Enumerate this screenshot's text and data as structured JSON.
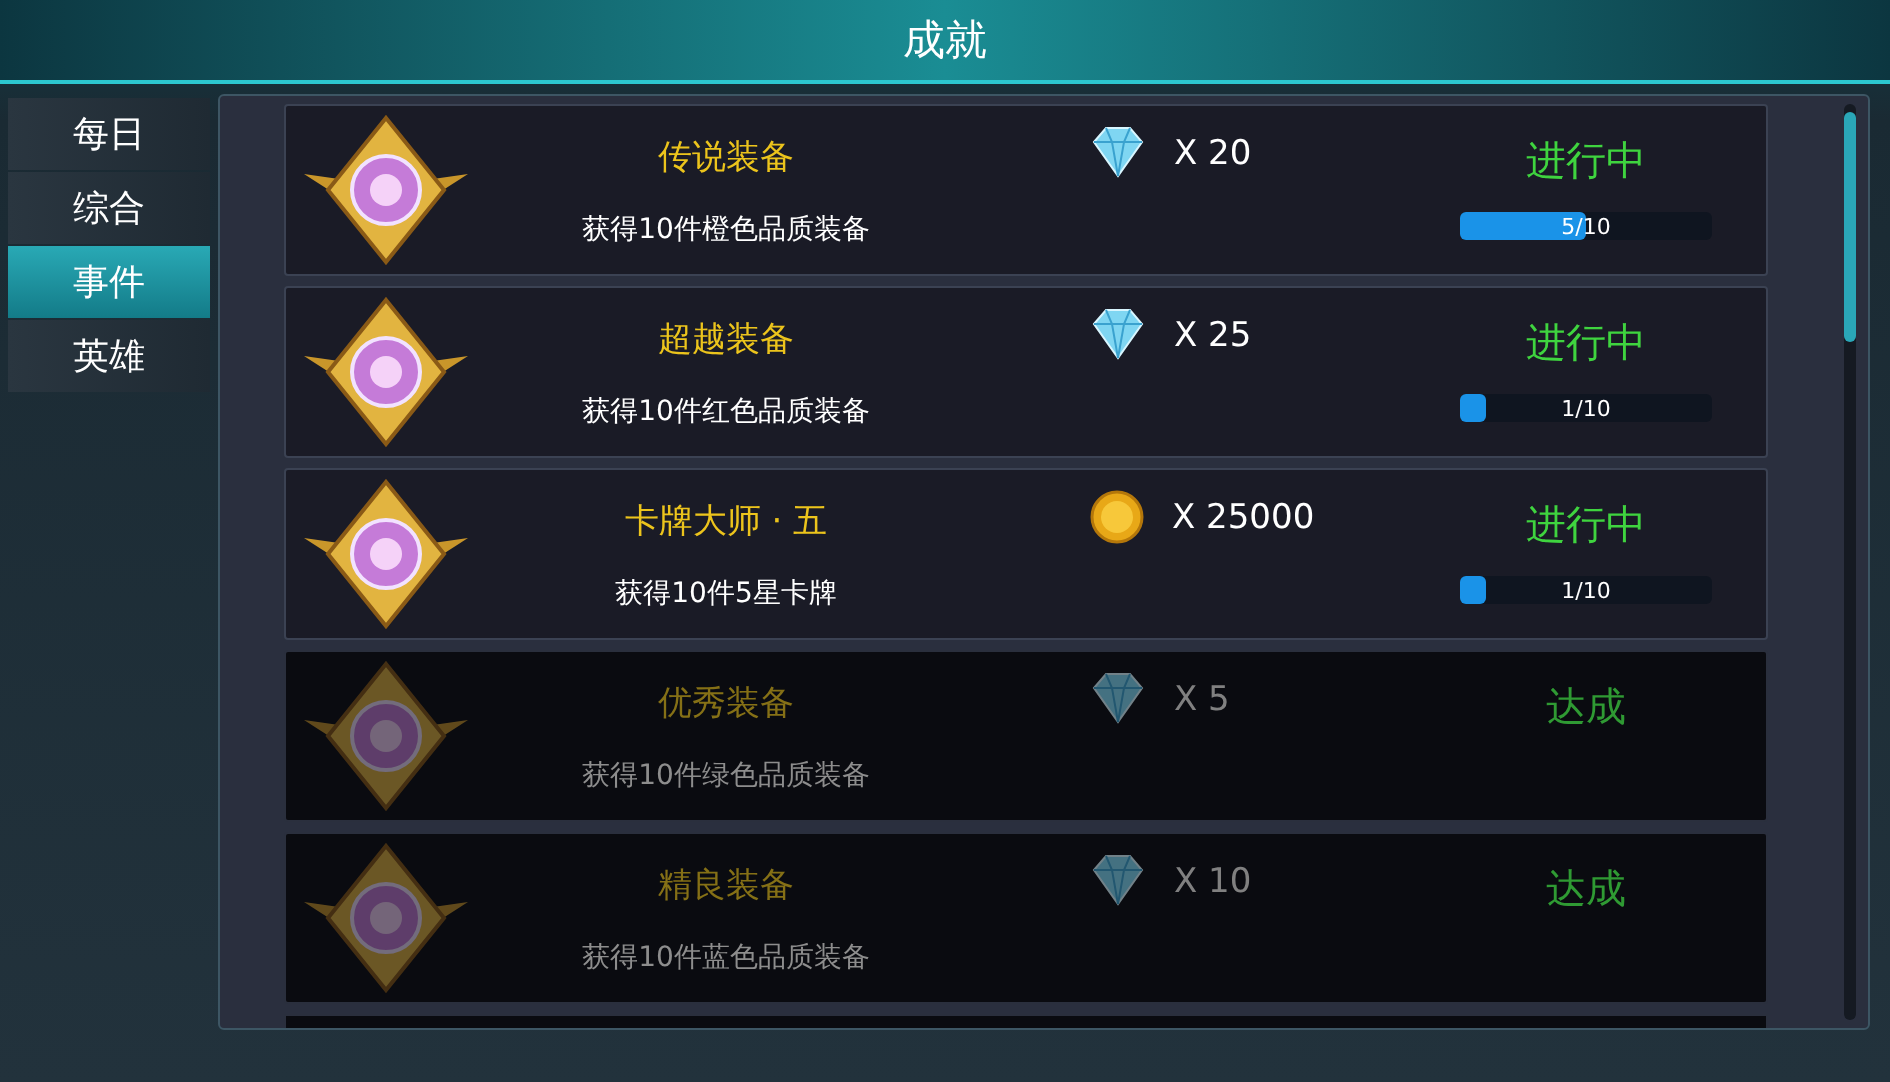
{
  "window": {
    "title": "成就"
  },
  "tabs": [
    {
      "label": "每日",
      "selected": false
    },
    {
      "label": "综合",
      "selected": false
    },
    {
      "label": "事件",
      "selected": true
    },
    {
      "label": "英雄",
      "selected": false
    }
  ],
  "achievements": [
    {
      "title": "传说装备",
      "description": "获得10件橙色品质装备",
      "reward": {
        "kind": "diamond",
        "amount": "X 20"
      },
      "status": "进行中",
      "completed": false,
      "progress": {
        "text": "5/10",
        "level": 0.5
      }
    },
    {
      "title": "超越装备",
      "description": "获得10件红色品质装备",
      "reward": {
        "kind": "diamond",
        "amount": "X 25"
      },
      "status": "进行中",
      "completed": false,
      "progress": {
        "text": "1/10",
        "level": 0.1
      }
    },
    {
      "title": "卡牌大师 · 五",
      "description": "获得10件5星卡牌",
      "reward": {
        "kind": "coin",
        "amount": "X 25000"
      },
      "status": "进行中",
      "completed": false,
      "progress": {
        "text": "1/10",
        "level": 0.1
      }
    },
    {
      "title": "优秀装备",
      "description": "获得10件绿色品质装备",
      "reward": {
        "kind": "diamond",
        "amount": "X 5"
      },
      "status": "达成",
      "completed": true
    },
    {
      "title": "精良装备",
      "description": "获得10件蓝色品质装备",
      "reward": {
        "kind": "diamond",
        "amount": "X 10"
      },
      "status": "达成",
      "completed": true
    }
  ]
}
